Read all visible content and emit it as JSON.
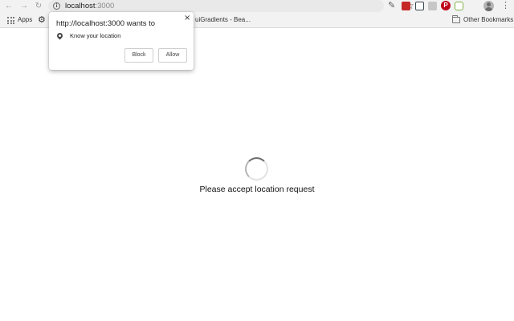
{
  "toolbar": {
    "url_host": "localhost",
    "url_port": ":3000",
    "back_icon": "arrow-left-icon",
    "forward_icon": "arrow-right-icon",
    "reload_icon": "reload-icon",
    "bookmark_icon": "star-icon",
    "menu_icon": "more-vertical-icon"
  },
  "extensions": [
    {
      "name": "eyedropper-icon",
      "color": "#5a5a5a"
    },
    {
      "name": "red-square-icon",
      "color": "#c62828"
    },
    {
      "name": "screen-icon",
      "color": "#37474f"
    },
    {
      "name": "gray-square-icon",
      "color": "#bdbdbd"
    },
    {
      "name": "gray-square-icon",
      "color": "#c7c7c7"
    },
    {
      "name": "pinterest-icon",
      "color": "#bd081c"
    },
    {
      "name": "node-hexagon-icon",
      "color": "#7cb342"
    }
  ],
  "bookmarks": {
    "apps_label": "Apps",
    "uigradients_label": "uiGradients - Bea...",
    "other_label": "Other Bookmarks"
  },
  "popup": {
    "title": "http://localhost:3000 wants to",
    "item": "Know your location",
    "block_label": "Block",
    "allow_label": "Allow",
    "close_glyph": "×"
  },
  "page": {
    "status": "Please accept location request"
  }
}
